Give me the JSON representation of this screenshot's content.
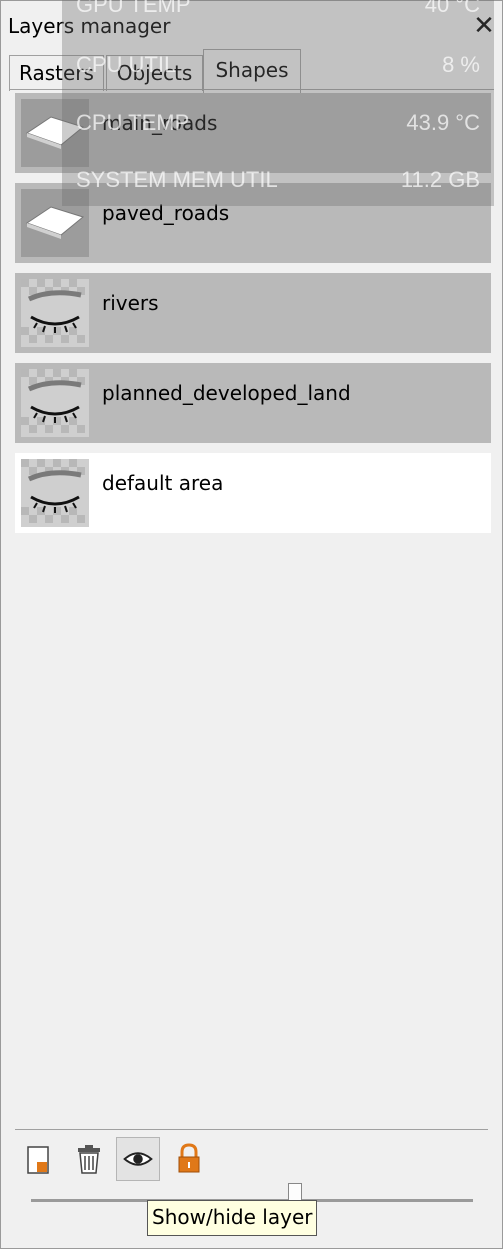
{
  "window": {
    "title": "Layers manager",
    "close_glyph": "✕"
  },
  "tabs": [
    {
      "label": "Rasters",
      "selected": false
    },
    {
      "label": "Objects",
      "selected": false
    },
    {
      "label": "Shapes",
      "selected": true
    }
  ],
  "layers": [
    {
      "name": "main_roads",
      "icon": "road-shape-icon",
      "highlight": "gray"
    },
    {
      "name": "paved_roads",
      "icon": "road-shape-icon",
      "highlight": "gray"
    },
    {
      "name": "rivers",
      "icon": "hidden-eye-icon",
      "highlight": "gray"
    },
    {
      "name": "planned_developed_land",
      "icon": "hidden-eye-icon",
      "highlight": "gray"
    },
    {
      "name": "default area",
      "icon": "hidden-eye-icon",
      "highlight": "white"
    }
  ],
  "overlay": [
    {
      "label": "GPU TEMP",
      "value": "40 °C"
    },
    {
      "label": "CPU UTIL",
      "value": "8 %"
    },
    {
      "label": "CPU TEMP",
      "value": "43.9 °C"
    },
    {
      "label": "SYSTEM MEM UTIL",
      "value": "11.2 GB"
    }
  ],
  "toolbar": {
    "tools": [
      "new-layer-icon",
      "delete-trash-icon",
      "eye-icon",
      "lock-icon"
    ],
    "active_tool": "eye-icon",
    "tooltip": "Show/hide layer"
  },
  "slider": {
    "value": 0.6
  },
  "colors": {
    "row_highlight": "#b9b9b9",
    "lock_orange": "#e07818"
  }
}
